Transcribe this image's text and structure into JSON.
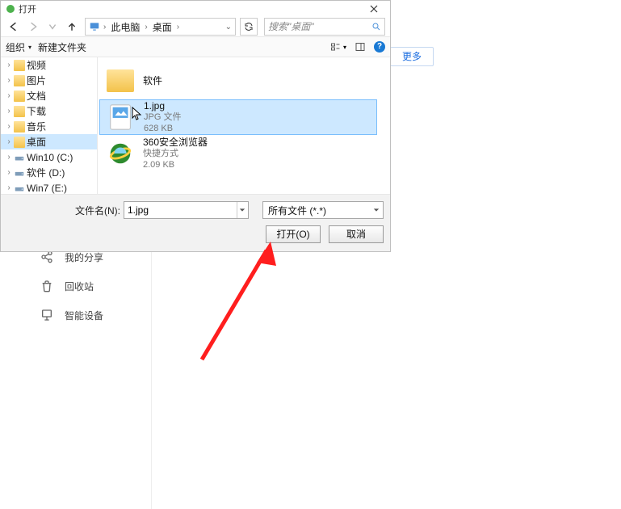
{
  "parent": {
    "more_button": "更多",
    "nav": {
      "share": "我的分享",
      "recycle": "回收站",
      "smart": "智能设备"
    }
  },
  "dialog": {
    "title": "打开"
  },
  "breadcrumb": {
    "seg1": "此电脑",
    "seg2": "桌面"
  },
  "search": {
    "placeholder": "搜索\"桌面\""
  },
  "toolbar": {
    "organize": "组织",
    "new_folder": "新建文件夹",
    "help": "?"
  },
  "tree": [
    {
      "label": "视频",
      "type": "folder",
      "sel": false
    },
    {
      "label": "图片",
      "type": "folder",
      "sel": false
    },
    {
      "label": "文档",
      "type": "folder",
      "sel": false
    },
    {
      "label": "下载",
      "type": "folder",
      "sel": false
    },
    {
      "label": "音乐",
      "type": "folder",
      "sel": false
    },
    {
      "label": "桌面",
      "type": "folder",
      "sel": true
    },
    {
      "label": "Win10 (C:)",
      "type": "drive",
      "sel": false
    },
    {
      "label": "软件 (D:)",
      "type": "drive",
      "sel": false
    },
    {
      "label": "Win7 (E:)",
      "type": "drive",
      "sel": false
    }
  ],
  "files": [
    {
      "kind": "folder",
      "name": "软件",
      "sub1": "",
      "sub2": "",
      "sel": false
    },
    {
      "kind": "jpg",
      "name": "1.jpg",
      "sub1": "JPG 文件",
      "sub2": "628 KB",
      "sel": true
    },
    {
      "kind": "ie",
      "name": "360安全浏览器",
      "sub1": "快捷方式",
      "sub2": "2.09 KB",
      "sel": false
    }
  ],
  "bottom": {
    "filename_label": "文件名(N):",
    "filename_value": "1.jpg",
    "filter_label": "所有文件 (*.*)",
    "open": "打开(O)",
    "cancel": "取消"
  }
}
